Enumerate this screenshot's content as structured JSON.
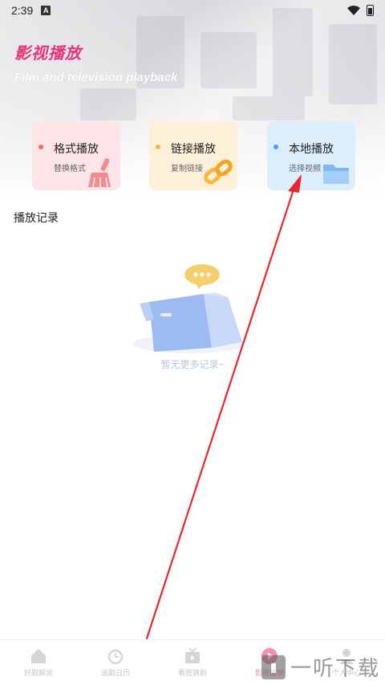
{
  "status_bar": {
    "time": "2:39",
    "notif_letter": "A"
  },
  "header": {
    "title": "影视播放",
    "subtitle": "Film and television playback"
  },
  "cards": [
    {
      "title": "格式播放",
      "subtitle": "替换格式",
      "icon": "broom-icon",
      "accent": "#f06a73"
    },
    {
      "title": "链接播放",
      "subtitle": "复制链接",
      "icon": "chain-link-icon",
      "accent": "#f5b53a"
    },
    {
      "title": "本地播放",
      "subtitle": "选择视频",
      "icon": "folder-icon",
      "accent": "#4d9df0"
    }
  ],
  "history": {
    "title": "播放记录",
    "empty_text": "暂无更多记录~"
  },
  "tabs": [
    {
      "label": "好剧解说",
      "icon": "home-icon"
    },
    {
      "label": "追剧日历",
      "icon": "alarm-clock-icon"
    },
    {
      "label": "看图猜剧",
      "icon": "tv-icon"
    },
    {
      "label": "影视播放",
      "icon": "play-circle-icon",
      "active": true
    },
    {
      "label": "个人中心",
      "icon": "user-icon"
    }
  ],
  "watermark": {
    "text": "一听下载"
  },
  "colors": {
    "brand": "#e8337a",
    "arrow": "#e8262c"
  }
}
